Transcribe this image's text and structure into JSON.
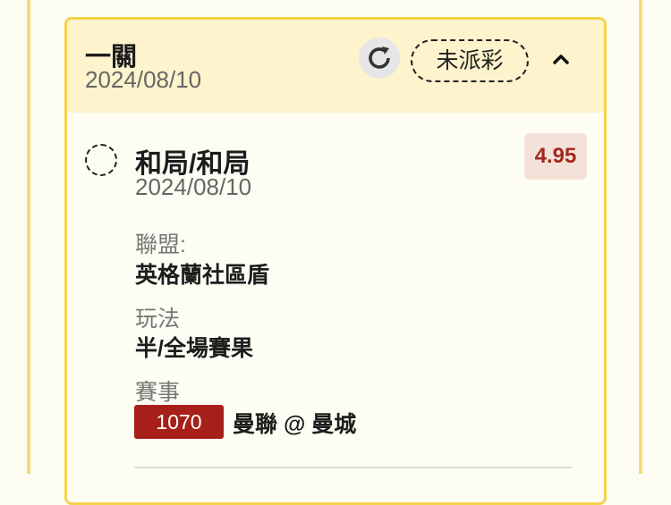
{
  "ticket": {
    "bet_type": "一關",
    "date": "2024/08/10",
    "status": "未派彩",
    "refresh_icon": "refresh-icon",
    "collapse_icon": "chevron-up-icon"
  },
  "selection": {
    "title": "和局/和局",
    "date": "2024/08/10",
    "odds": "4.95",
    "league_label": "聯盟:",
    "league_value": "英格蘭社區盾",
    "play_label": "玩法",
    "play_value": "半/全場賽果",
    "match_label": "賽事",
    "match_id": "1070",
    "match_teams": "曼聯 @ 曼城"
  },
  "colors": {
    "border": "#f3d44a",
    "header_bg": "#fdf3cc",
    "match_id_bg": "#a62019",
    "odds_text": "#a3291f"
  }
}
